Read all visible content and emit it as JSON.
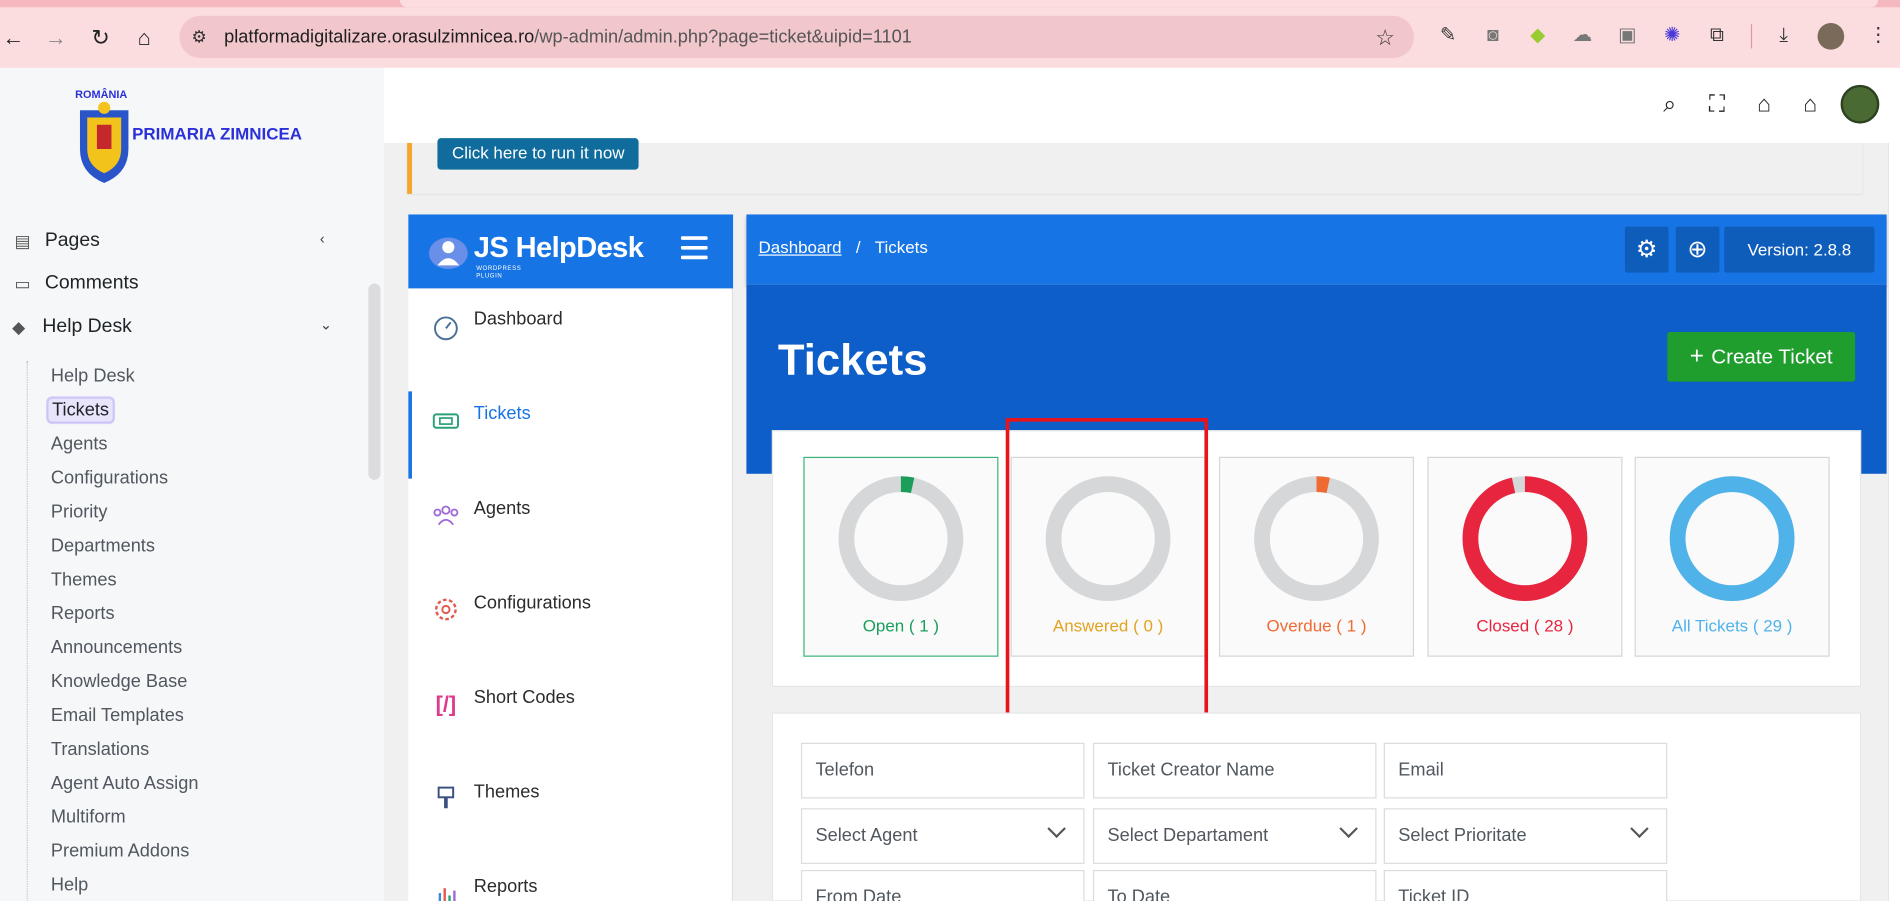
{
  "browser": {
    "url_host": "platformadigitalizare.orasulzimnicea.ro",
    "url_path": "/wp-admin/admin.php?page=ticket&uipid=1101"
  },
  "site_logo": {
    "country": "ROMÂNIA",
    "name": "PRIMARIA ZIMNICEA"
  },
  "wp_menu": {
    "pages": "Pages",
    "comments": "Comments",
    "helpdesk": "Help Desk",
    "submenu": [
      "Help Desk",
      "Tickets",
      "Agents",
      "Configurations",
      "Priority",
      "Departments",
      "Themes",
      "Reports",
      "Announcements",
      "Knowledge Base",
      "Email Templates",
      "Translations",
      "Agent Auto Assign",
      "Multiform",
      "Premium Addons",
      "Help"
    ]
  },
  "notice": {
    "button": "Click here to run it now"
  },
  "plugin": {
    "brand": "JS HelpDesk",
    "brand_sub": "WORDPRESS PLUGIN",
    "nav": [
      "Dashboard",
      "Tickets",
      "Agents",
      "Configurations",
      "Short Codes",
      "Themes",
      "Reports"
    ]
  },
  "breadcrumb": {
    "home": "Dashboard",
    "sep": "/",
    "current": "Tickets"
  },
  "version": "Version: 2.8.8",
  "page": {
    "title": "Tickets",
    "create": "Create Ticket"
  },
  "stats": [
    {
      "label": "Open ( 1 )",
      "count": 1,
      "color": "#1a9e5a"
    },
    {
      "label": "Answered ( 0 )",
      "count": 0,
      "color": "#e3a320"
    },
    {
      "label": "Overdue ( 1 )",
      "count": 1,
      "color": "#f06b34"
    },
    {
      "label": "Closed ( 28 )",
      "count": 28,
      "color": "#e8253f"
    },
    {
      "label": "All Tickets ( 29 )",
      "count": 29,
      "color": "#4fb3ea"
    }
  ],
  "total_tickets": 29,
  "filters": {
    "telefon": "Telefon",
    "creator": "Ticket Creator Name",
    "email": "Email",
    "agent": "Select Agent",
    "department": "Select Departament",
    "priority": "Select Prioritate",
    "from_date": "From Date",
    "to_date": "To Date",
    "ticket_id": "Ticket ID"
  }
}
